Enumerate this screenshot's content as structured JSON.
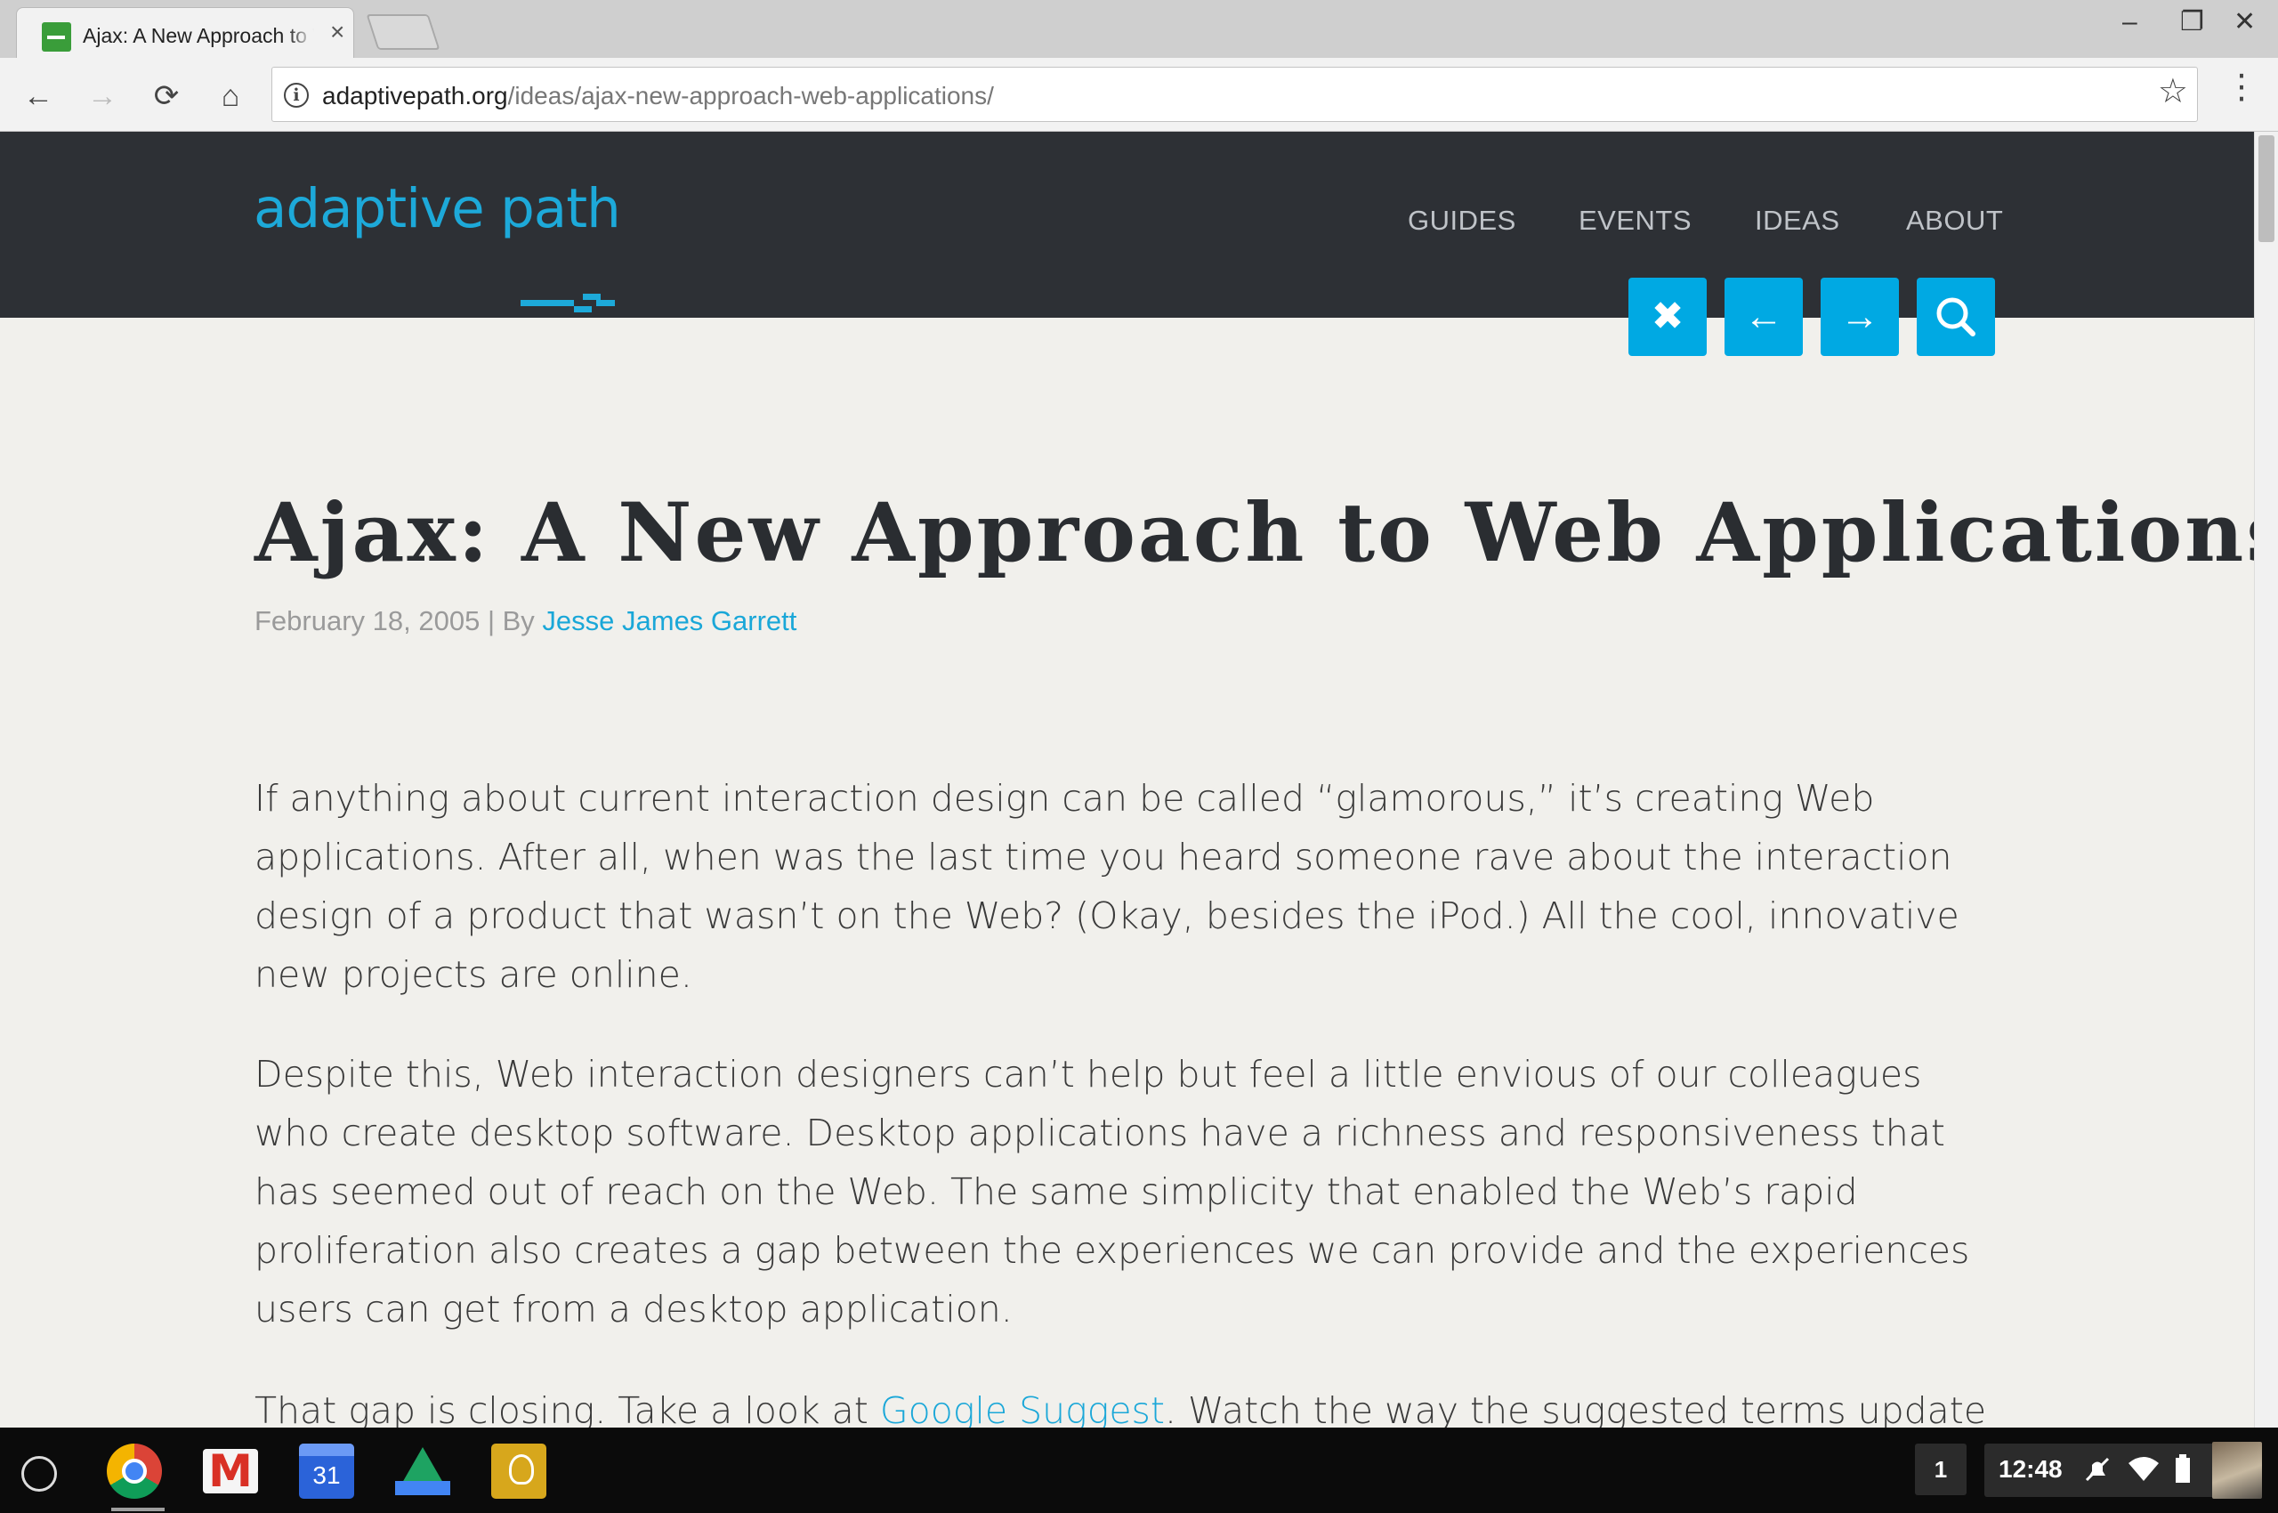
{
  "browser": {
    "tab_title": "Ajax: A New Approach to Web Applications",
    "close_glyph": "×",
    "url_host": "adaptivepath.org",
    "url_path": "/ideas/ajax-new-approach-web-applications/",
    "nav": {
      "back": "←",
      "forward": "→",
      "reload": "⟳",
      "home": "⌂"
    },
    "star_glyph": "☆",
    "menu_glyph": "⋮",
    "window": {
      "minimize": "–",
      "maximize": "❐",
      "close": "✕"
    }
  },
  "site": {
    "logo": "adaptive path",
    "nav": [
      "GUIDES",
      "EVENTS",
      "IDEAS",
      "ABOUT"
    ],
    "controls": {
      "close": "✖",
      "prev": "←",
      "next": "→",
      "search": "⚲"
    },
    "accent_color": "#00a9e3",
    "header_bg": "#2d3035"
  },
  "article": {
    "title": "Ajax: A New Approach to Web Applications",
    "date": "February 18, 2005",
    "by_sep": " | By ",
    "author": "Jesse James Garrett",
    "p1": "If anything about current interaction design can be called “glamorous,” it’s creating Web applications. After all, when was the last time you heard someone rave about the interaction design of a product that wasn’t on the Web? (Okay, besides the iPod.) All the cool, innovative new projects are online.",
    "p2": "Despite this, Web interaction designers can’t help but feel a little envious of our colleagues who create desktop software. Desktop applications have a richness and responsiveness that has seemed out of reach on the Web. The same simplicity that enabled the Web’s rapid proliferation also creates a gap between the experiences we can provide and the experiences users can get from a desktop application.",
    "p3_before": "That gap is closing. Take a look at ",
    "p3_link": "Google Suggest",
    "p3_after": ". Watch the way the suggested terms update"
  },
  "shelf": {
    "apps": [
      "chrome-icon",
      "gmail-icon",
      "calendar-icon",
      "drive-icon",
      "keep-icon"
    ],
    "calendar_day": "31",
    "notification_count": "1",
    "clock": "12:48"
  }
}
